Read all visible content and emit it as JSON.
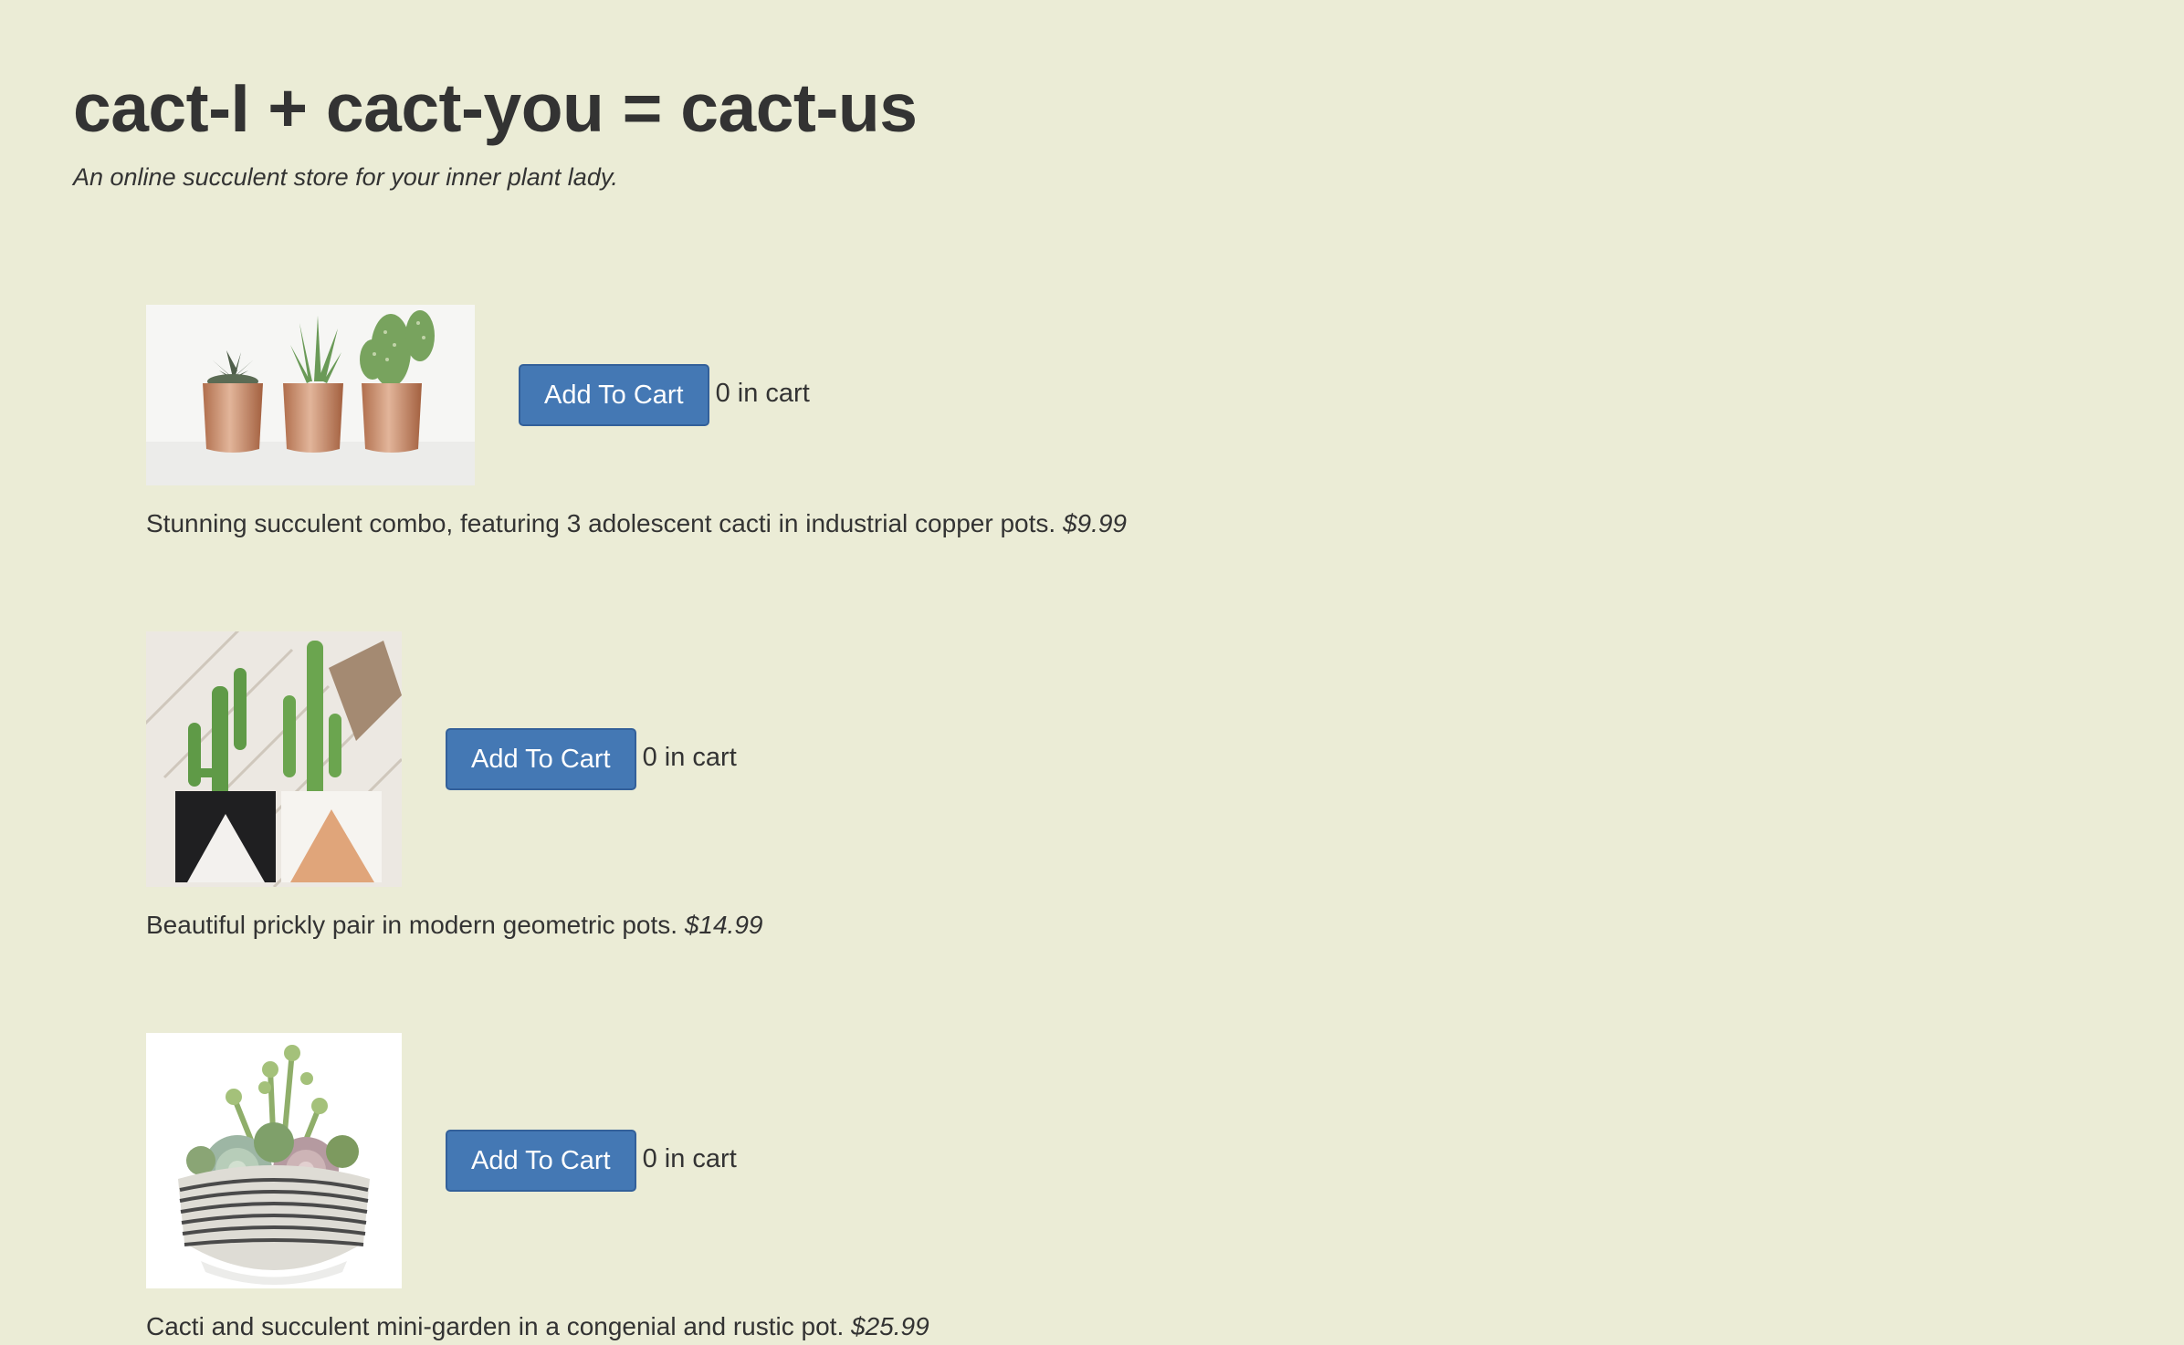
{
  "header": {
    "title": "cact-I + cact-you = cact-us",
    "subtitle": "An online succulent store for your inner plant lady."
  },
  "products": [
    {
      "image_icon": "three-cacti-copper-pots-image",
      "button_label": "Add To Cart",
      "cart_count": "0 in cart",
      "description": "Stunning succulent combo, featuring 3 adolescent cacti in industrial copper pots.",
      "price": "$9.99"
    },
    {
      "image_icon": "two-cacti-geometric-pots-image",
      "button_label": "Add To Cart",
      "cart_count": "0 in cart",
      "description": "Beautiful prickly pair in modern geometric pots.",
      "price": "$14.99"
    },
    {
      "image_icon": "succulent-mini-garden-bowl-image",
      "button_label": "Add To Cart",
      "cart_count": "0 in cart",
      "description": "Cacti and succulent mini-garden in a congenial and rustic pot.",
      "price": "$25.99"
    }
  ],
  "colors": {
    "background": "#ebecd6",
    "button": "#4478b4",
    "text": "#333333"
  }
}
